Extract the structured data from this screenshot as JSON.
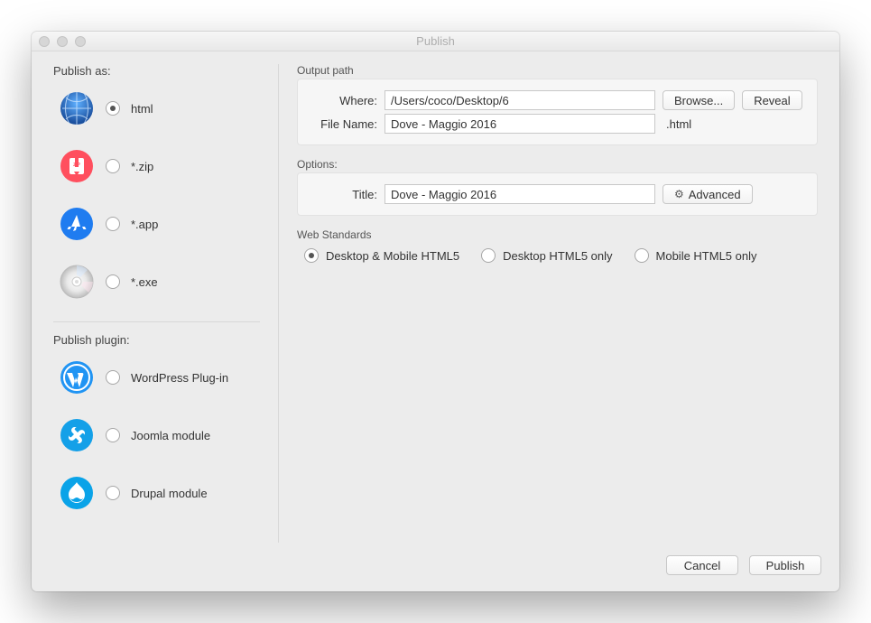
{
  "window": {
    "title": "Publish"
  },
  "sidebar": {
    "publish_as_label": "Publish as:",
    "publish_plugin_label": "Publish plugin:",
    "formats": {
      "html": "html",
      "zip": "*.zip",
      "app": "*.app",
      "exe": "*.exe"
    },
    "plugins": {
      "wordpress": "WordPress Plug-in",
      "joomla": "Joomla module",
      "drupal": "Drupal module"
    }
  },
  "output": {
    "group_label": "Output path",
    "where_label": "Where:",
    "where_value": "/Users/coco/Desktop/6",
    "filename_label": "File Name:",
    "filename_value": "Dove - Maggio 2016",
    "filename_suffix": ".html",
    "browse": "Browse...",
    "reveal": "Reveal"
  },
  "options": {
    "group_label": "Options:",
    "title_label": "Title:",
    "title_value": "Dove - Maggio 2016",
    "advanced": "Advanced"
  },
  "web_standards": {
    "group_label": "Web Standards",
    "opt_both": "Desktop & Mobile HTML5",
    "opt_desktop": "Desktop HTML5 only",
    "opt_mobile": "Mobile HTML5 only"
  },
  "footer": {
    "cancel": "Cancel",
    "publish": "Publish"
  }
}
